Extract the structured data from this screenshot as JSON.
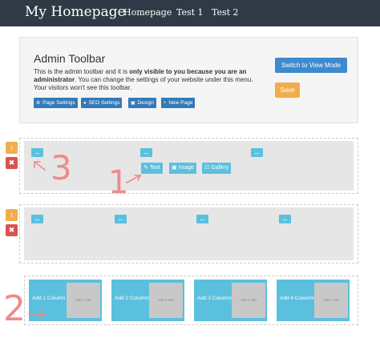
{
  "navbar": {
    "brand": "My Homepage",
    "links": [
      "Homepage",
      "Test 1",
      "Test 2"
    ]
  },
  "admin": {
    "title": "Admin Toolbar",
    "desc_pre": "This is the admin toolbar and it is ",
    "desc_bold": "only visible to you because you are an administrator",
    "desc_post": ". You can change the settings of your website under this menu. Your visitors won't see this toolbar.",
    "buttons": [
      {
        "icon": "⚙",
        "label": "Page Settings"
      },
      {
        "icon": "●",
        "label": "SEO Settings"
      },
      {
        "icon": "▣",
        "label": ""
      },
      {
        "icon": "",
        "label": "Design"
      },
      {
        "icon": "+",
        "label": "New Page"
      }
    ],
    "switch_label": "Switch to View Mode",
    "save_label": "Save"
  },
  "row1": {
    "handle_glyph": "↔",
    "element_buttons": [
      {
        "icon": "✎",
        "label": "Text"
      },
      {
        "icon": "▣",
        "label": "Image"
      },
      {
        "icon": "☷",
        "label": "Gallery"
      }
    ]
  },
  "side": {
    "move_glyph": "↕",
    "delete_glyph": "✖"
  },
  "columns": [
    {
      "label": "Add 1 Column",
      "placeholder": "100 x 100"
    },
    {
      "label": "Add 2 Columns",
      "placeholder": "100 x 100"
    },
    {
      "label": "Add 3 Columns",
      "placeholder": "100 x 100"
    },
    {
      "label": "Add 4 Columns",
      "placeholder": "100 x 100"
    }
  ],
  "annotations": [
    "1",
    "2",
    "3"
  ],
  "colors": {
    "navbar": "#2f3a46",
    "primary": "#337ab7",
    "info": "#5bc0de",
    "warning": "#f0ad4e",
    "danger": "#d9534f",
    "annotation": "#f08a8a"
  },
  "icons": {
    "page_settings": "gear-icon",
    "seo_settings": "globe-icon",
    "design": "image-icon",
    "new_page": "plus-icon",
    "move": "move-vertical-icon",
    "delete": "trash-icon",
    "text": "pencil-icon",
    "image": "image-icon",
    "gallery": "grid-icon",
    "column_handle": "resize-horizontal-icon"
  }
}
